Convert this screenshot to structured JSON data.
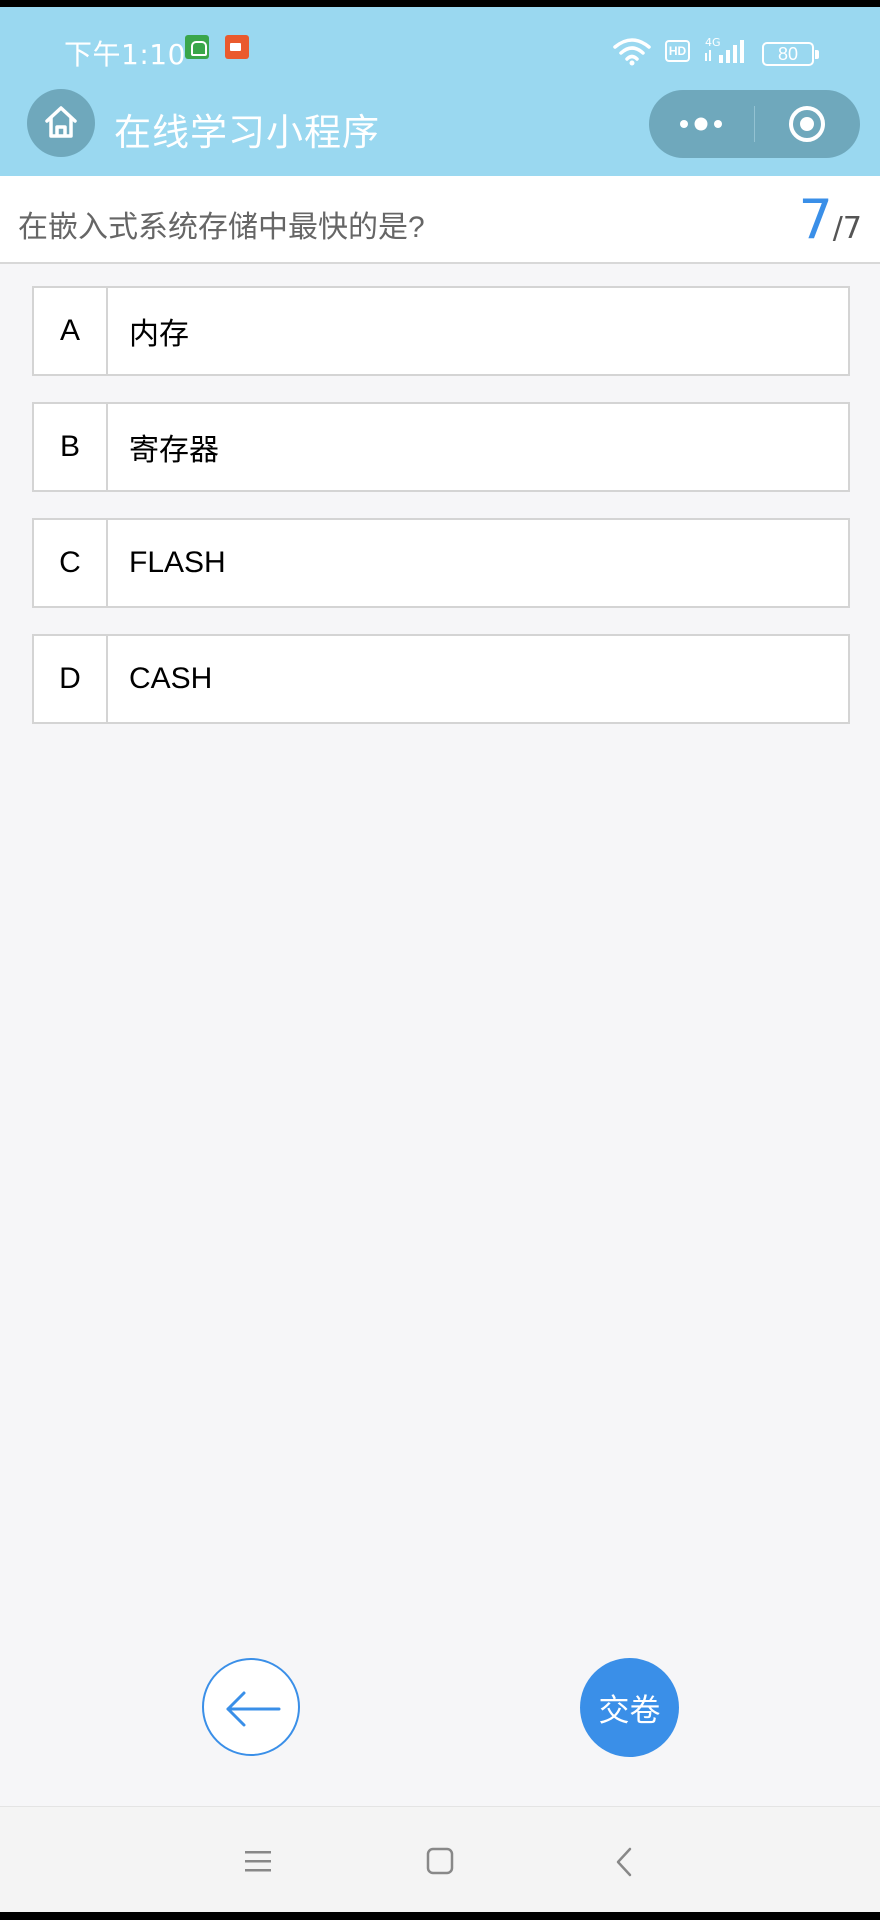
{
  "status_bar": {
    "time": "下午1:10",
    "hd": "HD",
    "network": "4G",
    "battery": "80"
  },
  "nav": {
    "title": "在线学习小程序",
    "home_icon": "home-icon",
    "more_icon": "more-dots-icon",
    "close_icon": "target-close-icon"
  },
  "question": {
    "text": "在嵌入式系统存储中最快的是?",
    "current": "7",
    "total": "/7"
  },
  "options": [
    {
      "letter": "A",
      "text": "内存"
    },
    {
      "letter": "B",
      "text": "寄存器"
    },
    {
      "letter": "C",
      "text": "FLASH"
    },
    {
      "letter": "D",
      "text": "CASH"
    }
  ],
  "actions": {
    "back_icon": "arrow-left-icon",
    "submit_label": "交卷"
  },
  "colors": {
    "header": "#9ad8f0",
    "accent": "#3a8fe8",
    "capsule": "#6fa8bc"
  }
}
